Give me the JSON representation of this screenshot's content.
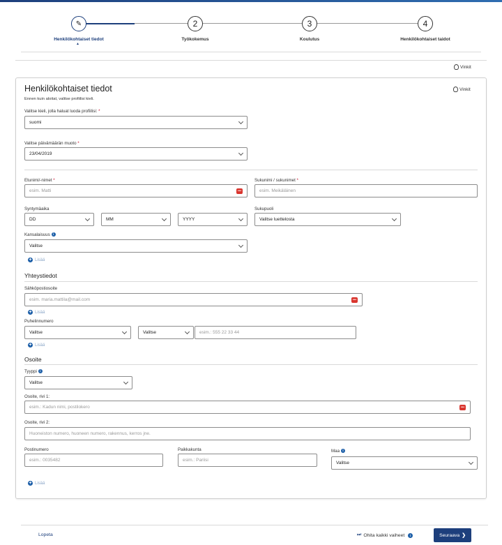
{
  "stepper": {
    "steps": [
      {
        "number": "✎",
        "label": "Henkilökohtaiset tiedot",
        "active": true
      },
      {
        "number": "2",
        "label": "Työkokemus"
      },
      {
        "number": "3",
        "label": "Koulutus"
      },
      {
        "number": "4",
        "label": "Henkilökohtaiset taidot"
      }
    ]
  },
  "tips_label": "Vinkit",
  "card": {
    "title": "Henkilökohtaiset tiedot",
    "subtitle": "Ennen kuin aloitat, valitse profiilisi kieli.",
    "tips_label": "Vinkit",
    "language": {
      "label": "Valitse kieli, jolla haluat luoda profiilisi:",
      "value": "suomi"
    },
    "date_format": {
      "label": "Valitse päivämäärän muoto",
      "value": "23/04/2019"
    },
    "first_name": {
      "label": "Etunimi/-nimet",
      "placeholder": "esim. Matti"
    },
    "last_name": {
      "label": "Sukunimi / sukunimet",
      "placeholder": "esim. Meikäläinen"
    },
    "birth": {
      "label": "Syntymäaika",
      "day": "DD",
      "month": "MM",
      "year": "YYYY"
    },
    "gender": {
      "label": "Sukupuoli",
      "value": "Valitse luettelosta"
    },
    "nationality": {
      "label": "Kansalaisuus",
      "value": "Valitse"
    },
    "add_label": "Lisää",
    "contact": {
      "heading": "Yhteystiedot",
      "email_label": "Sähköpostiosoite",
      "email_placeholder": "esim. maria.mattila@mail.com",
      "phone_label": "Puhelinnumero",
      "phone_type": "Valitse",
      "phone_code": "Valitse",
      "phone_placeholder": "esim.: 555 22 33 44"
    },
    "address": {
      "heading": "Osoite",
      "type_label": "Tyyppi",
      "type_value": "Valitse",
      "line1_label": "Osoite, rivi 1:",
      "line1_placeholder": "esim.: Kadun nimi, postilokero",
      "line2_label": "Osoite, rivi 2:",
      "line2_placeholder": "Huoneiston numero, huoneen numero, rakennus, kerros jne.",
      "postcode_label": "Postinumero",
      "postcode_placeholder": "esim.: 0035482",
      "city_label": "Paikkakunta",
      "city_placeholder": "esim.: Pariisi",
      "country_label": "Maa",
      "country_value": "Valitse"
    }
  },
  "footer": {
    "quit": "Lopeta",
    "skip": "Ohita kaikki vaiheet",
    "next": "Seuraava"
  },
  "colors": {
    "accent": "#1d3f7c",
    "required": "#c8102e",
    "error_icon": "#d9352e"
  }
}
